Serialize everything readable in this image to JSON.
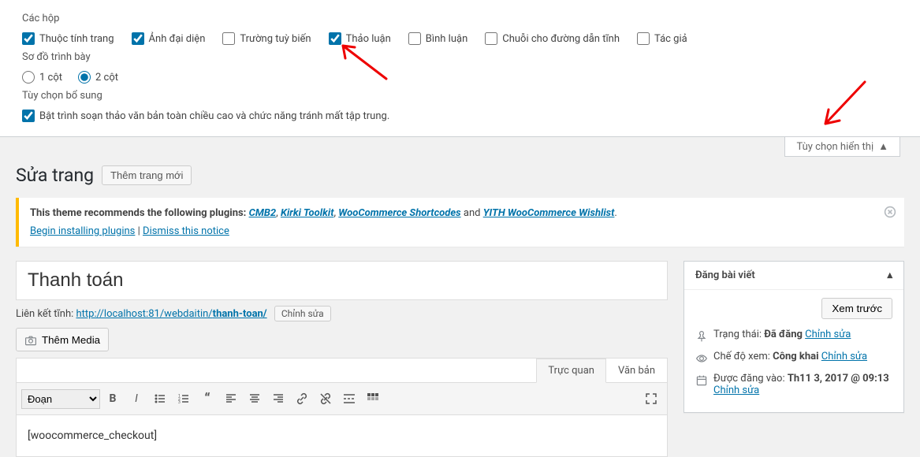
{
  "top": {
    "section1": "Các hộp",
    "cb": [
      {
        "label": "Thuộc tính trang",
        "checked": true
      },
      {
        "label": "Ảnh đại diện",
        "checked": true
      },
      {
        "label": "Trường tuỳ biến",
        "checked": false
      },
      {
        "label": "Thảo luận",
        "checked": true
      },
      {
        "label": "Bình luận",
        "checked": false
      },
      {
        "label": "Chuỗi cho đường dẫn tĩnh",
        "checked": false
      },
      {
        "label": "Tác giả",
        "checked": false
      }
    ],
    "section2": "Sơ đồ trình bày",
    "radios": [
      {
        "label": "1 cột",
        "checked": false
      },
      {
        "label": "2 cột",
        "checked": true
      }
    ],
    "section3": "Tùy chọn bổ sung",
    "extra": {
      "label": "Bật trình soạn thảo văn bản toàn chiều cao và chức năng tránh mất tập trung.",
      "checked": true
    },
    "toggle": "Tùy chọn hiển thị"
  },
  "heading": {
    "title": "Sửa trang",
    "btn": "Thêm trang mới"
  },
  "notice": {
    "prefix": "This theme recommends the following plugins: ",
    "links": [
      "CMB2",
      "Kirki Toolkit",
      "WooCommerce Shortcodes"
    ],
    "and": " and ",
    "last": "YITH WooCommerce Wishlist",
    "dot": ".",
    "begin": "Begin installing plugins",
    "sep": " | ",
    "dismiss": "Dismiss this notice"
  },
  "editor": {
    "title": "Thanh toán",
    "permalink_label": "Liên kết tĩnh: ",
    "permalink_base": "http://localhost:81/webdaitin/",
    "permalink_slug": "thanh-toan/",
    "permalink_edit": "Chỉnh sửa",
    "media_btn": "Thêm Media",
    "tab_visual": "Trực quan",
    "tab_text": "Văn bản",
    "format": "Đoạn",
    "content": "[woocommerce_checkout]"
  },
  "publish": {
    "heading": "Đăng bài viết",
    "preview": "Xem trước",
    "status_lbl": "Trạng thái: ",
    "status_val": "Đã đăng",
    "status_edit": "Chỉnh sửa",
    "vis_lbl": "Chế độ xem: ",
    "vis_val": "Công khai",
    "vis_edit": "Chỉnh sửa",
    "date_lbl": "Được đăng vào: ",
    "date_val": "Th11 3, 2017 @ 09:13",
    "date_edit": "Chỉnh sửa"
  }
}
